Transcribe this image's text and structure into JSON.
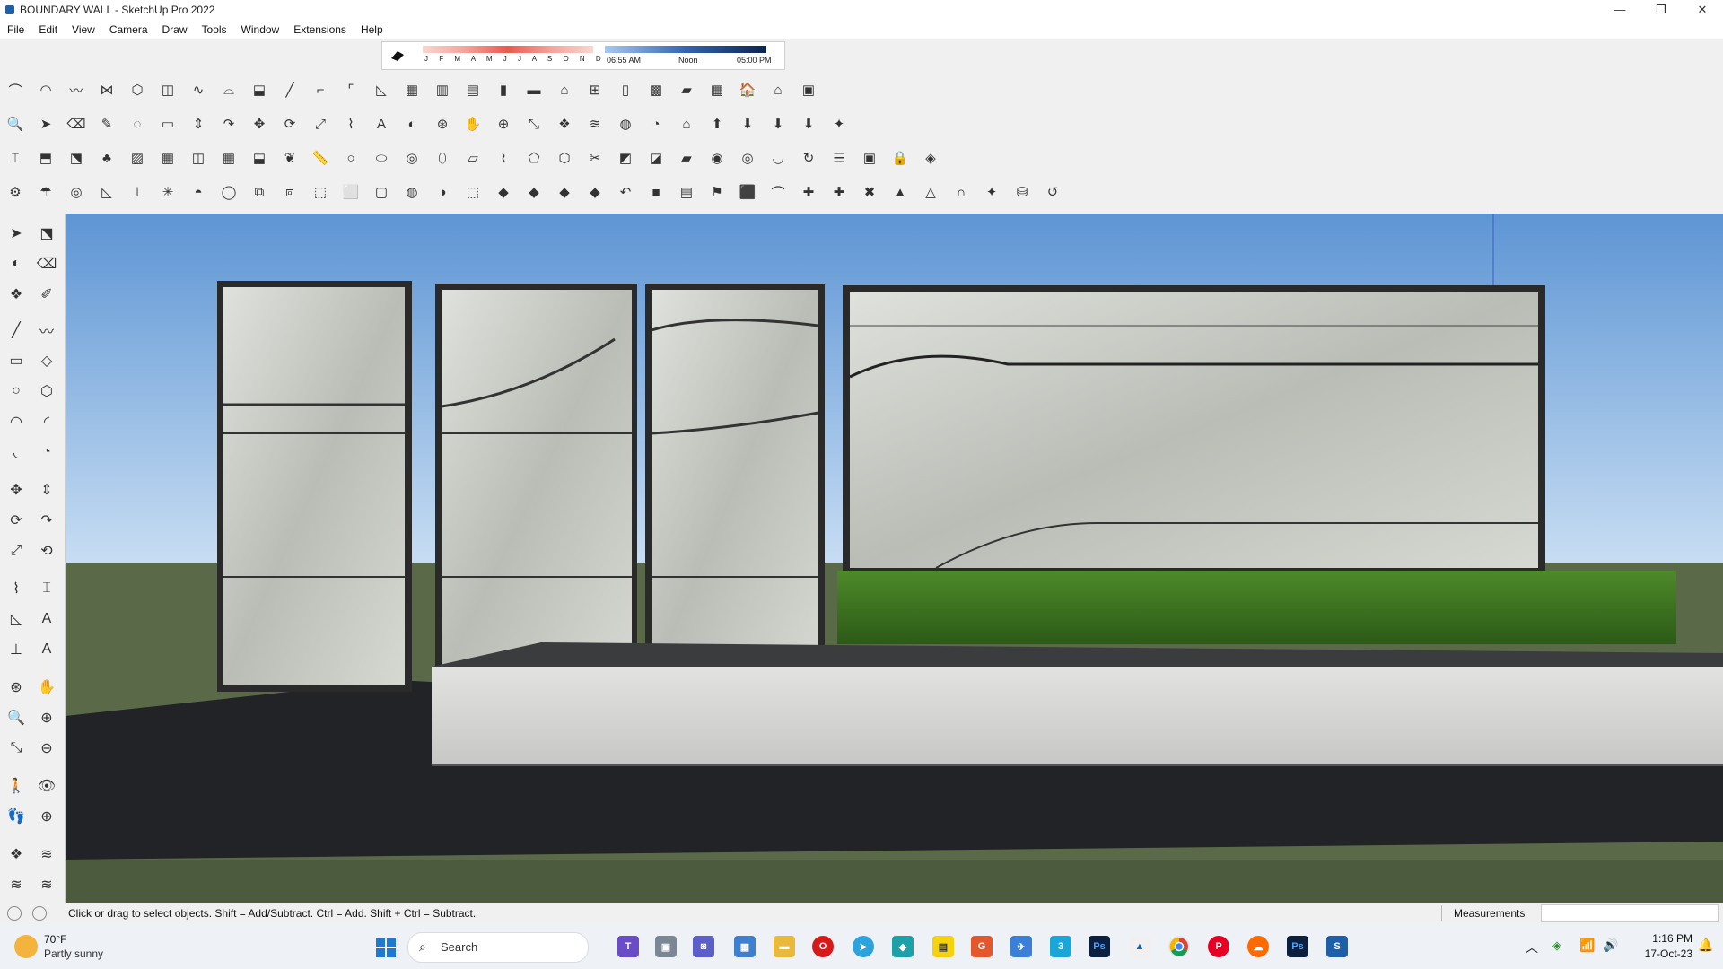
{
  "window": {
    "title": "BOUNDARY WALL - SketchUp Pro 2022"
  },
  "menu": [
    "File",
    "Edit",
    "View",
    "Camera",
    "Draw",
    "Tools",
    "Window",
    "Extensions",
    "Help"
  ],
  "shadows": {
    "months": "J F M A M J J A S O N D",
    "time_start": "06:55 AM",
    "time_mid": "Noon",
    "time_end": "05:00 PM"
  },
  "status": {
    "hint": "Click or drag to select objects. Shift = Add/Subtract. Ctrl = Add. Shift + Ctrl = Subtract.",
    "measurements_label": "Measurements",
    "measurements_value": ""
  },
  "taskbar": {
    "weather_temp": "70°F",
    "weather_desc": "Partly sunny",
    "search_placeholder": "Search",
    "clock_time": "1:16 PM",
    "clock_date": "17-Oct-23"
  },
  "colors": {
    "sky_top": "#5d95d4",
    "sky_bottom": "#c9def3",
    "grass": "#5a6a48",
    "marble": "#cfd3cc",
    "frame": "#2a2a2a",
    "hedge": "#3c7a1e"
  }
}
